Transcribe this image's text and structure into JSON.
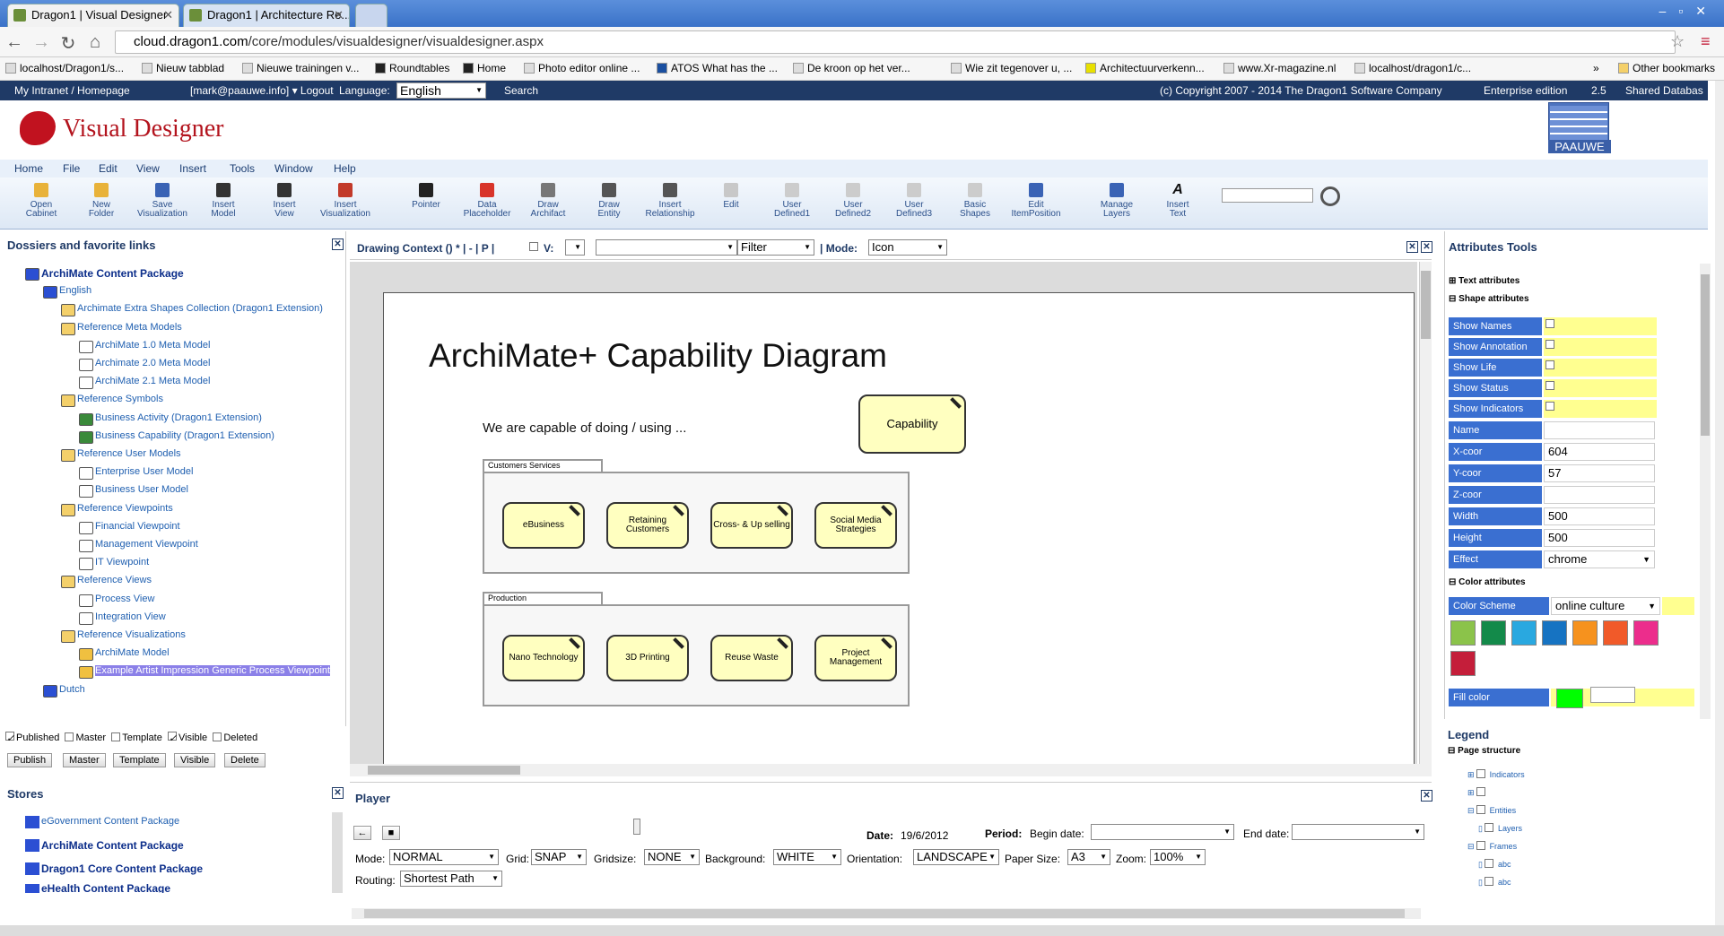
{
  "browser": {
    "tabs": [
      {
        "title": "Dragon1 | Visual Designer"
      },
      {
        "title": "Dragon1 | Architecture Re..."
      }
    ],
    "url_host": "cloud.dragon1.com",
    "url_path": "/core/modules/visualdesigner/visualdesigner.aspx",
    "bookmarks": [
      "localhost/Dragon1/s...",
      "Nieuw tabblad",
      "Nieuwe trainingen v...",
      "Roundtables",
      "Home",
      "Photo editor online ...",
      "ATOS What has the ...",
      "De kroon op het ver...",
      "Wie zit tegenover u, ...",
      "Architectuurverkenn...",
      "www.Xr-magazine.nl",
      "localhost/dragon1/c..."
    ],
    "overflow": "»",
    "other_bookmarks": "Other bookmarks"
  },
  "header": {
    "intranet": "My Intranet / Homepage",
    "user": "[mark@paauwe.info] ▾ Logout",
    "language_label": "Language:",
    "language": "English",
    "search": "Search",
    "copyright": "(c) Copyright 2007 - 2014 The Dragon1 Software Company",
    "edition": "Enterprise edition",
    "version": "2.5",
    "db": "Shared Databas"
  },
  "app": {
    "title": "Visual Designer",
    "partner": "PAAUWE"
  },
  "menu": [
    "Home",
    "File",
    "Edit",
    "View",
    "Insert",
    "Tools",
    "Window",
    "Help"
  ],
  "toolbar": [
    {
      "l1": "Open",
      "l2": "Cabinet",
      "color": "#e8b23a"
    },
    {
      "l1": "New",
      "l2": "Folder",
      "color": "#e8b23a"
    },
    {
      "l1": "Save",
      "l2": "Visualization",
      "color": "#3a63b5"
    },
    {
      "l1": "Insert",
      "l2": "Model",
      "color": "#333333"
    },
    {
      "l1": "Insert",
      "l2": "View",
      "color": "#333333"
    },
    {
      "l1": "Insert",
      "l2": "Visualization",
      "color": "#c23a2a"
    },
    {
      "l1": "Pointer",
      "l2": "",
      "color": "#222222"
    },
    {
      "l1": "Data",
      "l2": "Placeholder",
      "color": "#d8342a"
    },
    {
      "l1": "Draw",
      "l2": "Archifact",
      "color": "#777777"
    },
    {
      "l1": "Draw",
      "l2": "Entity",
      "color": "#555555"
    },
    {
      "l1": "Insert",
      "l2": "Relationship",
      "color": "#555555"
    },
    {
      "l1": "Edit",
      "l2": "",
      "color": "#c8c8c8"
    },
    {
      "l1": "User",
      "l2": "Defined1",
      "color": "#cccccc"
    },
    {
      "l1": "User",
      "l2": "Defined2",
      "color": "#cccccc"
    },
    {
      "l1": "User",
      "l2": "Defined3",
      "color": "#cccccc"
    },
    {
      "l1": "Basic",
      "l2": "Shapes",
      "color": "#cccccc"
    },
    {
      "l1": "Edit",
      "l2": "ItemPosition",
      "color": "#3a63b5"
    },
    {
      "l1": "Manage",
      "l2": "Layers",
      "color": "#3a63b5"
    },
    {
      "l1": "Insert",
      "l2": "Text",
      "color": "#111111"
    }
  ],
  "left": {
    "title": "Dossiers and favorite links",
    "tree": [
      {
        "label": "ArchiMate Content Package",
        "bold": true,
        "icon": "db"
      },
      {
        "label": "English",
        "icon": "db-small"
      },
      {
        "label": "Archimate Extra Shapes Collection (Dragon1 Extension)",
        "icon": "folder"
      },
      {
        "label": "Reference Meta Models",
        "icon": "folder"
      },
      {
        "label": "ArchiMate 1.0 Meta Model",
        "icon": "model"
      },
      {
        "label": "Archimate 2.0 Meta Model",
        "icon": "model"
      },
      {
        "label": "ArchiMate 2.1 Meta Model",
        "icon": "model"
      },
      {
        "label": "Reference Symbols",
        "icon": "folder"
      },
      {
        "label": "Business Activity (Dragon1 Extension)",
        "icon": "image"
      },
      {
        "label": "Business Capability (Dragon1 Extension)",
        "icon": "image"
      },
      {
        "label": "Reference User Models",
        "icon": "folder"
      },
      {
        "label": "Enterprise User Model",
        "icon": "model"
      },
      {
        "label": "Business User Model",
        "icon": "model"
      },
      {
        "label": "Reference Viewpoints",
        "icon": "folder"
      },
      {
        "label": "Financial Viewpoint",
        "icon": "view"
      },
      {
        "label": "Management Viewpoint",
        "icon": "view"
      },
      {
        "label": "IT Viewpoint",
        "icon": "view"
      },
      {
        "label": "Reference Views",
        "icon": "folder"
      },
      {
        "label": "Process View",
        "icon": "view"
      },
      {
        "label": "Integration View",
        "icon": "view"
      },
      {
        "label": "Reference Visualizations",
        "icon": "folder"
      },
      {
        "label": "ArchiMate Model",
        "icon": "vis"
      },
      {
        "label": "Example Artist Impression Generic Process Viewpoint",
        "icon": "vis",
        "selected": true
      },
      {
        "label": "Dutch",
        "icon": "db-small"
      }
    ],
    "checks": [
      {
        "label": "Published",
        "checked": true
      },
      {
        "label": "Master",
        "checked": false
      },
      {
        "label": "Template",
        "checked": false
      },
      {
        "label": "Visible",
        "checked": true
      },
      {
        "label": "Deleted",
        "checked": false
      }
    ],
    "buttons": [
      "Publish",
      "Master",
      "Template",
      "Visible",
      "Delete"
    ],
    "stores_title": "Stores",
    "stores": [
      "eGovernment Content Package",
      "ArchiMate Content Package",
      "Dragon1 Core Content Package",
      "eHealth Content Package"
    ]
  },
  "context": {
    "label": "Drawing Context () * | - | P |",
    "v_label": "V:",
    "filter": "Filter",
    "mode_label": "| Mode:",
    "mode": "Icon"
  },
  "diagram": {
    "title": "ArchiMate+ Capability Diagram",
    "subtitle": "We are capable of doing / using ...",
    "legend_capability": "Capability",
    "groups": [
      {
        "label": "Customers Services",
        "items": [
          "eBusiness",
          "Retaining Customers",
          "Cross- & Up selling",
          "Social Media Strategies"
        ]
      },
      {
        "label": "Production",
        "items": [
          "Nano Technology",
          "3D Printing",
          "Reuse Waste",
          "Project Management"
        ]
      }
    ]
  },
  "player": {
    "title": "Player",
    "date_label": "Date:",
    "date": "19/6/2012",
    "period_label": "Period:",
    "begin_label": "Begin date:",
    "end_label": "End date:",
    "mode_label": "Mode:",
    "mode": "NORMAL",
    "grid_label": "Grid:",
    "grid": "SNAP",
    "gridsize_label": "Gridsize:",
    "gridsize": "NONE",
    "bg_label": "Background:",
    "bg": "WHITE",
    "orient_label": "Orientation:",
    "orient": "LANDSCAPE",
    "paper_label": "Paper Size:",
    "paper": "A3",
    "zoom_label": "Zoom:",
    "zoom": "100%",
    "routing_label": "Routing:",
    "routing": "Shortest Path"
  },
  "right": {
    "title": "Attributes Tools",
    "text_attr": "Text attributes",
    "shape_attr": "Shape attributes",
    "toggles": [
      "Show Names",
      "Show Annotation",
      "Show Life",
      "Show Status",
      "Show Indicators"
    ],
    "fields": [
      {
        "label": "Name",
        "value": ""
      },
      {
        "label": "X-coor",
        "value": "604"
      },
      {
        "label": "Y-coor",
        "value": "57"
      },
      {
        "label": "Z-coor",
        "value": ""
      },
      {
        "label": "Width",
        "value": "500"
      },
      {
        "label": "Height",
        "value": "500"
      },
      {
        "label": "Effect",
        "value": "chrome"
      }
    ],
    "color_attr": "Color attributes",
    "scheme_label": "Color Scheme",
    "scheme": "online culture",
    "swatches": [
      "#8bc34a",
      "#138a4a",
      "#29a8e0",
      "#1673c2",
      "#f6921e",
      "#f15a29",
      "#ec2d8c",
      "#c41e3a"
    ],
    "fill_label": "Fill color",
    "fill": "#00ff00",
    "legend_title": "Legend",
    "page_structure": "Page structure",
    "legend_items": [
      "Indicators",
      "",
      "Entities",
      "Layers",
      "Frames",
      "abc",
      "abc"
    ]
  }
}
